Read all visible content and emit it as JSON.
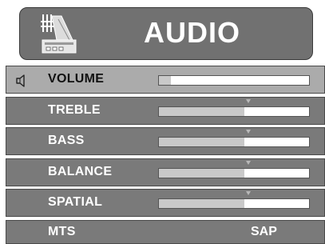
{
  "header": {
    "title": "AUDIO",
    "icon": "gramophone-icon"
  },
  "menu": {
    "volume": {
      "label": "VOLUME",
      "level": 0.08,
      "icon": "speaker-icon"
    },
    "treble": {
      "label": "TREBLE",
      "level": 0.57
    },
    "bass": {
      "label": "BASS",
      "level": 0.57
    },
    "balance": {
      "label": "BALANCE",
      "level": 0.57
    },
    "spatial": {
      "label": "SPATIAL",
      "level": 0.57
    },
    "mts": {
      "label": "MTS",
      "value": "SAP"
    }
  },
  "colors": {
    "row_bg": "#7a7a7a",
    "row_selected_bg": "#ababab",
    "header_bg": "#717171"
  }
}
